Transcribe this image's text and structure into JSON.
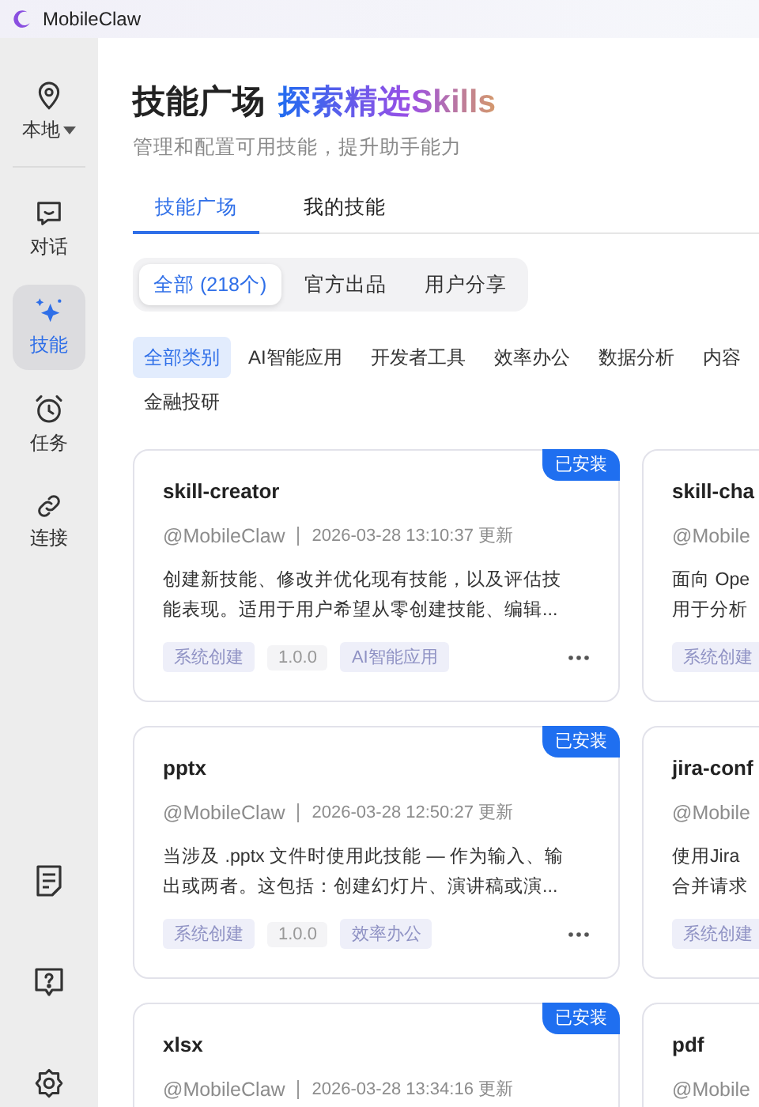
{
  "app": {
    "title": "MobileClaw"
  },
  "sidebar": {
    "location": {
      "label": "本地"
    },
    "items": [
      {
        "label": "对话",
        "selected": false
      },
      {
        "label": "技能",
        "selected": true
      },
      {
        "label": "任务",
        "selected": false
      },
      {
        "label": "连接",
        "selected": false
      }
    ]
  },
  "header": {
    "title": "技能广场",
    "highlight": "探索精选Skills",
    "subtitle": "管理和配置可用技能，提升助手能力"
  },
  "tabs": [
    {
      "label": "技能广场",
      "selected": true
    },
    {
      "label": "我的技能",
      "selected": false
    }
  ],
  "sources": [
    {
      "label": "全部 (218个)",
      "selected": true
    },
    {
      "label": "官方出品",
      "selected": false
    },
    {
      "label": "用户分享",
      "selected": false
    }
  ],
  "categories": [
    {
      "label": "全部类别",
      "selected": true
    },
    {
      "label": "AI智能应用",
      "selected": false
    },
    {
      "label": "开发者工具",
      "selected": false
    },
    {
      "label": "效率办公",
      "selected": false
    },
    {
      "label": "数据分析",
      "selected": false
    },
    {
      "label": "内容",
      "selected": false
    },
    {
      "label": "金融投研",
      "selected": false
    }
  ],
  "cards": [
    {
      "title": "skill-creator",
      "author": "@MobileClaw",
      "updated": "2026-03-28 13:10:37 更新",
      "description": "创建新技能、修改并优化现有技能，以及评估技能表现。适用于用户希望从零创建技能、编辑...",
      "badge": "已安装",
      "tags": [
        {
          "label": "系统创建",
          "kind": "label"
        },
        {
          "label": "1.0.0",
          "kind": "version"
        },
        {
          "label": "AI智能应用",
          "kind": "label"
        }
      ]
    },
    {
      "title": "skill-cha",
      "author": "@Mobile",
      "description": "面向 Ope\n用于分析",
      "tags": [
        {
          "label": "系统创建",
          "kind": "label"
        }
      ]
    },
    {
      "title": "pptx",
      "author": "@MobileClaw",
      "updated": "2026-03-28 12:50:27 更新",
      "description": "当涉及 .pptx 文件时使用此技能 — 作为输入、输出或两者。这包括：创建幻灯片、演讲稿或演...",
      "badge": "已安装",
      "tags": [
        {
          "label": "系统创建",
          "kind": "label"
        },
        {
          "label": "1.0.0",
          "kind": "version"
        },
        {
          "label": "效率办公",
          "kind": "label"
        }
      ]
    },
    {
      "title": "jira-conf",
      "author": "@Mobile",
      "description": "使用Jira\n合并请求",
      "tags": [
        {
          "label": "系统创建",
          "kind": "label"
        }
      ]
    },
    {
      "title": "xlsx",
      "author": "@MobileClaw",
      "updated": "2026-03-28 13:34:16 更新",
      "badge": "已安装"
    },
    {
      "title": "pdf",
      "author": "@Mobile"
    }
  ]
}
